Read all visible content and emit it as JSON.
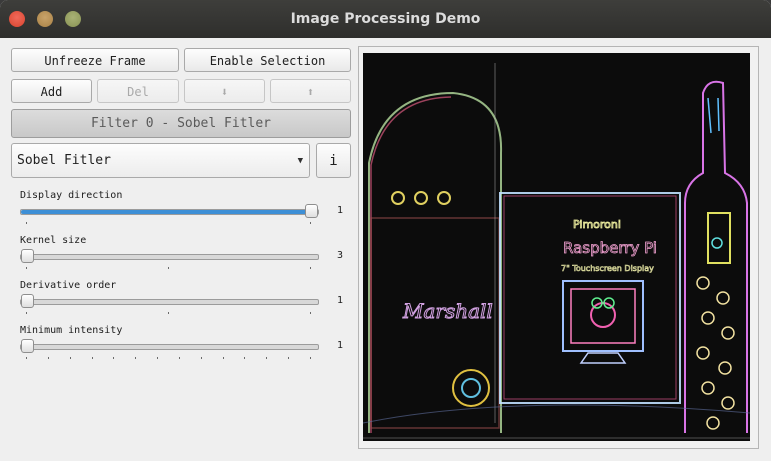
{
  "window": {
    "title": "Image Processing Demo"
  },
  "toolbar": {
    "unfreeze_label": "Unfreeze Frame",
    "selection_label": "Enable Selection",
    "add_label": "Add",
    "del_label": "Del",
    "down_label": "⬇",
    "up_label": "⬆"
  },
  "filter": {
    "header": "Filter 0 - Sobel Fitler",
    "selected": "Sobel Fitler",
    "info_label": "i"
  },
  "sliders": [
    {
      "label": "Display direction",
      "value": "1",
      "fraction": 1.0
    },
    {
      "label": "Kernel size",
      "value": "3",
      "fraction": 0.0
    },
    {
      "label": "Derivative order",
      "value": "1",
      "fraction": 0.0
    },
    {
      "label": "Minimum intensity",
      "value": "1",
      "fraction": 0.0
    }
  ],
  "image": {
    "description_icon": "edge-detected-image"
  }
}
